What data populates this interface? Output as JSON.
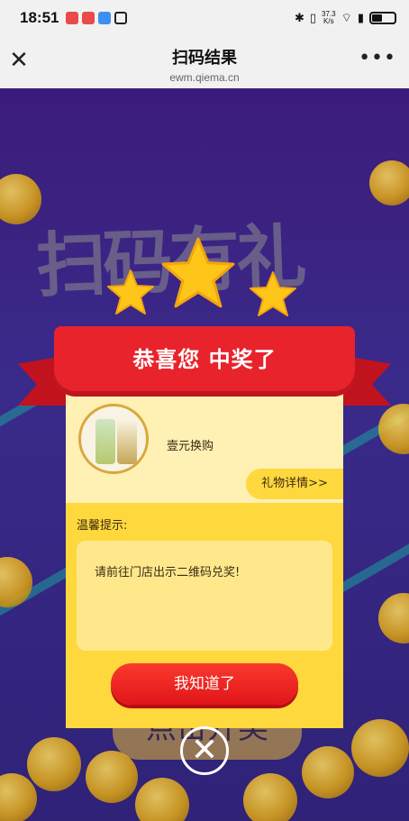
{
  "status_bar": {
    "time": "18:51",
    "net_speed_value": "37.3",
    "net_speed_unit": "K/s",
    "battery_level": 0.45
  },
  "title_bar": {
    "title": "扫码结果",
    "domain": "ewm.qiema.cn",
    "close_icon": "close-icon",
    "more_icon": "more-icon"
  },
  "background": {
    "banner_text": "扫码有礼",
    "button_text": "点击开奖"
  },
  "modal": {
    "ribbon_text": "恭喜您 中奖了",
    "gift_name": "壹元换购",
    "detail_button": "礼物详情>>",
    "tip_label": "温馨提示:",
    "tip_text": "请前往门店出示二维码兑奖!",
    "confirm_button": "我知道了"
  },
  "colors": {
    "ribbon": "#e8232c",
    "modal": "#ffd83d",
    "button": "#f93a2c",
    "background": "#3c1c7a"
  }
}
